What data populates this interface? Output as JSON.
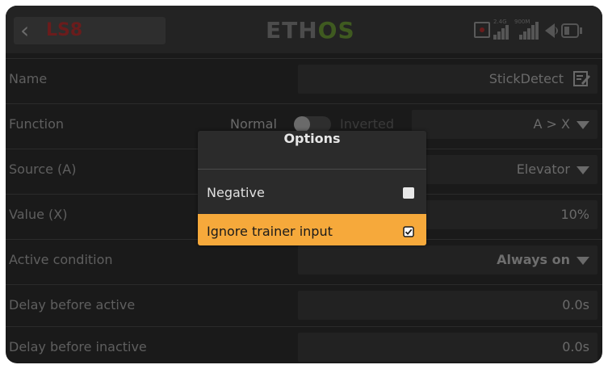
{
  "header": {
    "back_label": "LS8",
    "logo_main": "ETH",
    "logo_accent": "OS",
    "status": {
      "rx_label": "2.4G",
      "tx_label": "900M"
    }
  },
  "rows": [
    {
      "label": "Name",
      "value": "StickDetect",
      "control": "text-edit"
    },
    {
      "label": "Function",
      "toggle_left": "Normal",
      "toggle_right": "Inverted",
      "value": "A > X",
      "control": "dropdown"
    },
    {
      "label": "Source (A)",
      "value": "Elevator",
      "control": "dropdown"
    },
    {
      "label": "Value (X)",
      "value": "10%",
      "control": "number"
    },
    {
      "label": "Active condition",
      "value": "Always on",
      "control": "dropdown"
    },
    {
      "label": "Delay before active",
      "value": "0.0s",
      "control": "number"
    },
    {
      "label": "Delay before inactive",
      "value": "0.0s",
      "control": "number"
    }
  ],
  "dialog": {
    "title": "Options",
    "options": [
      {
        "label": "Negative",
        "checked": false,
        "selected": false
      },
      {
        "label": "Ignore trainer input",
        "checked": true,
        "selected": true
      }
    ]
  },
  "colors": {
    "accent": "#F6A93B",
    "background": "#1a1a1a",
    "dialog_bg": "#2b2b2b"
  },
  "icons": [
    "back-chevron-icon",
    "rx-signal-icon",
    "tx-signal-icon",
    "speaker-icon",
    "battery-icon",
    "edit-icon",
    "dropdown-arrow-icon",
    "checkbox-icon"
  ]
}
